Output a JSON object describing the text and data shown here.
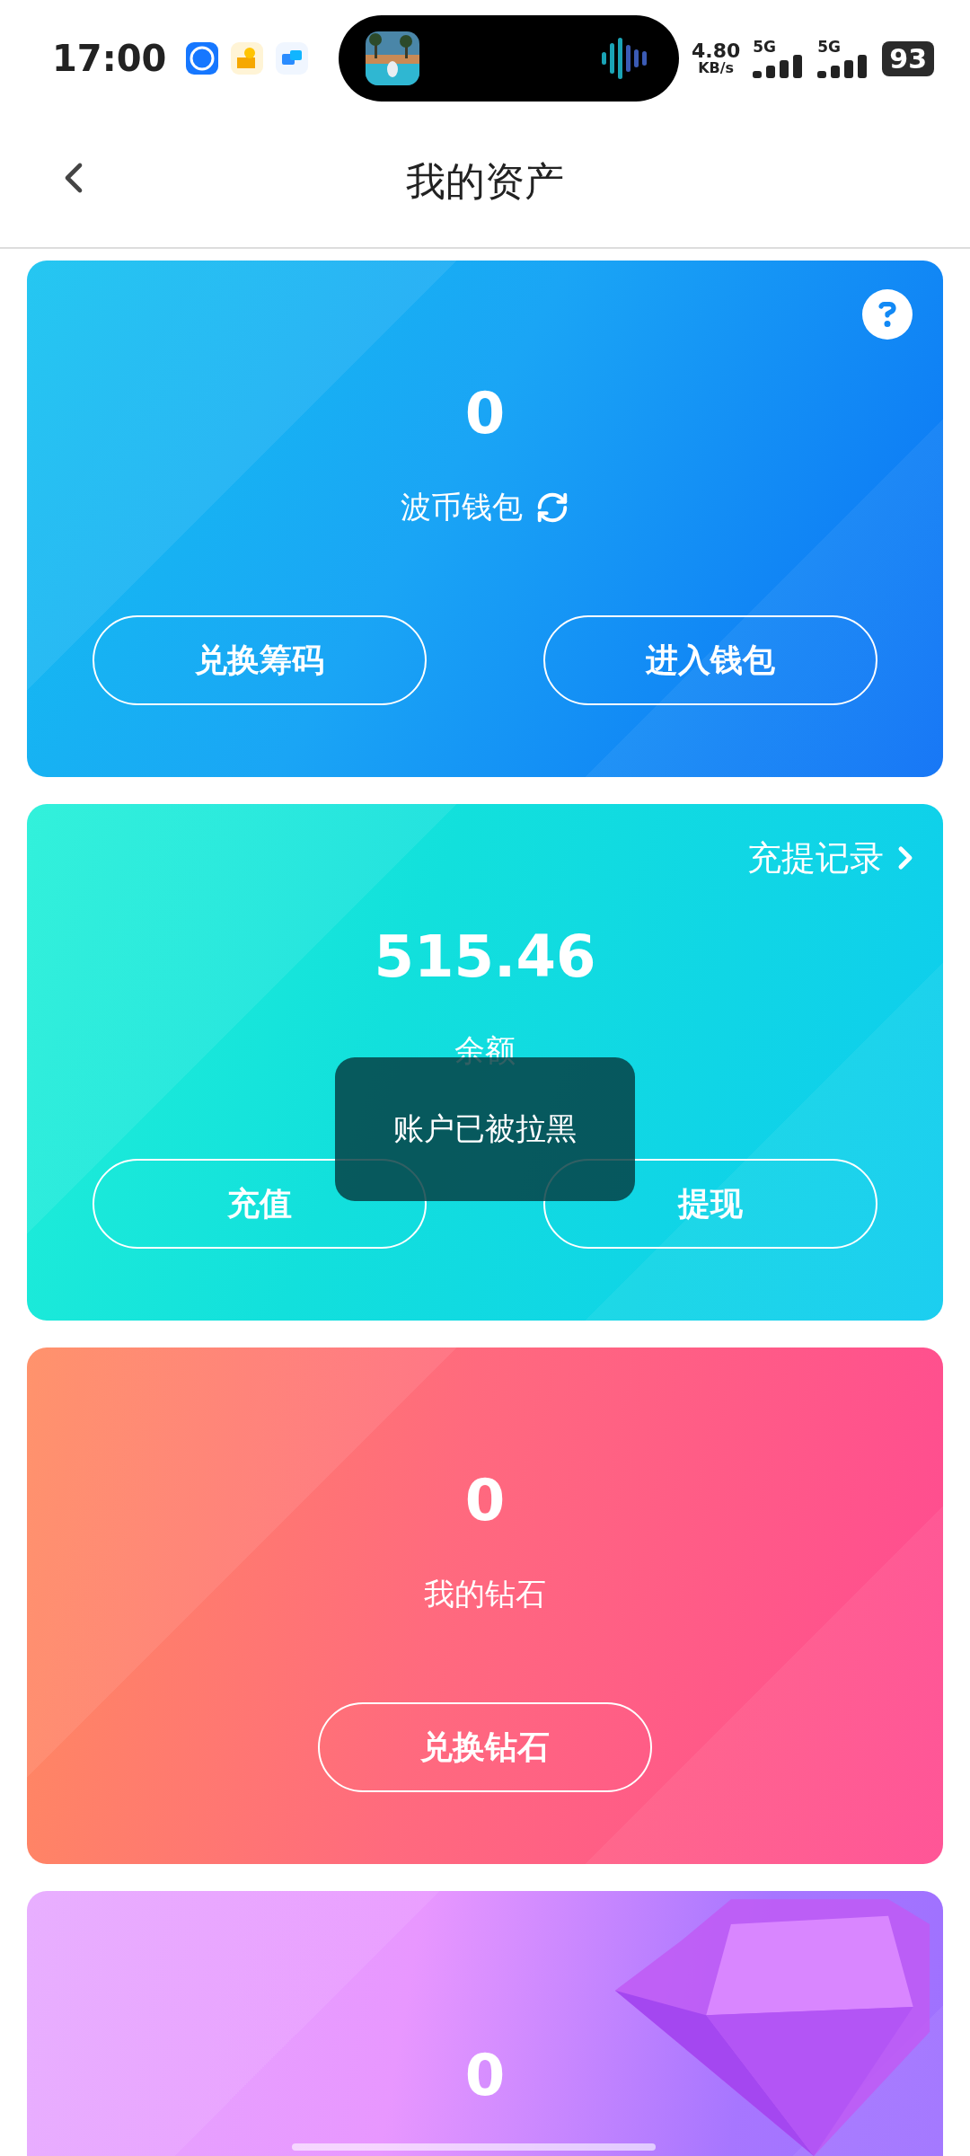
{
  "status_bar": {
    "time": "17:00",
    "net_speed": "4.80",
    "net_unit": "KB/s",
    "signals": [
      "5G",
      "5G"
    ],
    "battery": "93"
  },
  "header": {
    "title": "我的资产"
  },
  "cards": [
    {
      "kind": "wallet",
      "amount": "0",
      "label": "波币钱包",
      "buttons": [
        "兑换筹码",
        "进入钱包"
      ]
    },
    {
      "kind": "balance",
      "amount": "515.46",
      "label": "余额",
      "link": "充提记录",
      "buttons": [
        "充值",
        "提现"
      ]
    },
    {
      "kind": "diamond",
      "amount": "0",
      "label": "我的钻石",
      "buttons": [
        "兑换钻石"
      ]
    },
    {
      "kind": "gem",
      "amount": "0"
    }
  ],
  "toast": {
    "text": "账户已被拉黑"
  }
}
